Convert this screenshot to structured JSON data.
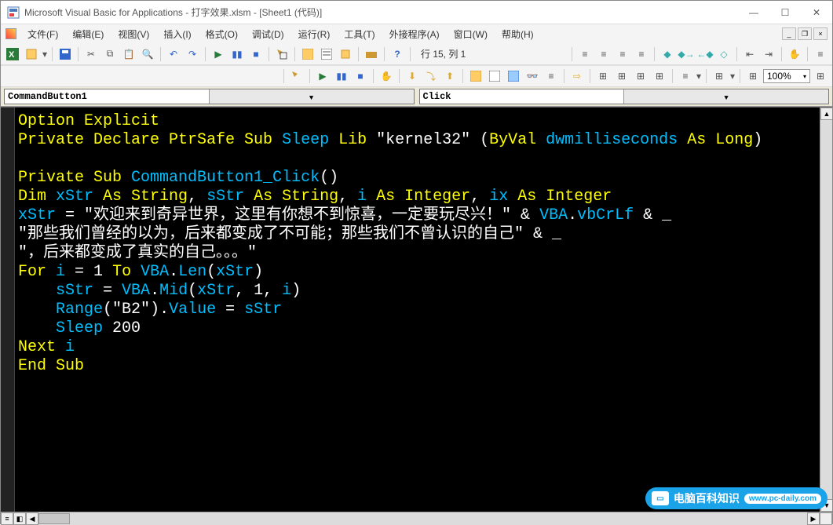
{
  "window": {
    "title": "Microsoft Visual Basic for Applications - 打字效果.xlsm - [Sheet1 (代码)]"
  },
  "menu": {
    "file": "文件(F)",
    "edit": "编辑(E)",
    "view": "视图(V)",
    "insert": "插入(I)",
    "format": "格式(O)",
    "debug": "调试(D)",
    "run": "运行(R)",
    "tools": "工具(T)",
    "addins": "外接程序(A)",
    "window": "窗口(W)",
    "help": "帮助(H)"
  },
  "toolbar": {
    "status": "行 15, 列 1",
    "zoom": "100%"
  },
  "dropdowns": {
    "object": "CommandButton1",
    "procedure": "Click"
  },
  "code": {
    "l1_kw1": "Option Explicit",
    "l2_kw1": "Private Declare PtrSafe Sub",
    "l2_id1": " Sleep ",
    "l2_kw2": "Lib",
    "l2_str1": " \"kernel32\" ",
    "l2_p1": "(",
    "l2_kw3": "ByVal",
    "l2_id2": " dwmilliseconds ",
    "l2_kw4": "As Long",
    "l2_p2": ")",
    "l4_kw1": "Private Sub",
    "l4_id1": " CommandButton1_Click",
    "l4_p1": "()",
    "l5_kw1": "Dim",
    "l5_id1": " xStr ",
    "l5_kw2": "As String",
    "l5_p1": ", ",
    "l5_id2": "sStr ",
    "l5_kw3": "As String",
    "l5_p2": ", ",
    "l5_id3": "i ",
    "l5_kw4": "As Integer",
    "l5_p3": ", ",
    "l5_id4": "ix ",
    "l5_kw5": "As Integer",
    "l6_id1": "xStr ",
    "l6_op": "= ",
    "l6_str": "\"欢迎来到奇异世界，这里有你想不到惊喜，一定要玩尽兴！\" ",
    "l6_op2": "& ",
    "l6_id2": "VBA",
    "l6_dot": ".",
    "l6_id3": "vbCrLf ",
    "l6_op3": "& _",
    "l7_str": "\"那些我们曾经的以为，后来都变成了不可能；那些我们不曾认识的自己\"",
    "l7_op": " & _",
    "l8_str": "\"，后来都变成了真实的自己。。。\"",
    "l9_kw1": "For",
    "l9_id1": " i ",
    "l9_op1": "= ",
    "l9_n1": "1 ",
    "l9_kw2": "To",
    "l9_id2": " VBA",
    "l9_dot": ".",
    "l9_id3": "Len",
    "l9_p1": "(",
    "l9_id4": "xStr",
    "l9_p2": ")",
    "l10_id1": "    sStr ",
    "l10_op": "= ",
    "l10_id2": "VBA",
    "l10_dot": ".",
    "l10_id3": "Mid",
    "l10_p1": "(",
    "l10_id4": "xStr",
    "l10_c1": ", ",
    "l10_n1": "1",
    "l10_c2": ", ",
    "l10_id5": "i",
    "l10_p2": ")",
    "l11_id1": "    Range",
    "l11_p1": "(",
    "l11_str": "\"B2\"",
    "l11_p2": ").",
    "l11_id2": "Value ",
    "l11_op": "= ",
    "l11_id3": "sStr",
    "l12_id1": "    Sleep",
    "l12_n1": " 200",
    "l13_kw1": "Next",
    "l13_id1": " i",
    "l14_kw1": "End Sub"
  },
  "watermark": {
    "title": "电脑百科知识",
    "url": "www.pc-daily.com"
  }
}
